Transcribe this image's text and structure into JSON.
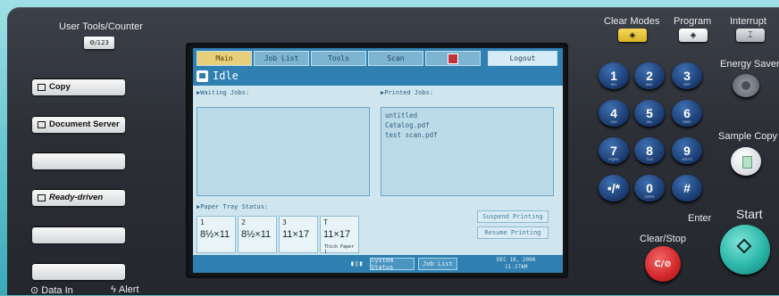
{
  "panel": {
    "user_tools_label": "User Tools/Counter",
    "user_tools_key_icon": "⚙/123",
    "data_in_label": "Data In",
    "alert_label": "Alert"
  },
  "function_keys": [
    {
      "label": "Copy",
      "icon": "copy-icon"
    },
    {
      "label": "Document Server",
      "icon": "document-server-icon"
    },
    {
      "label": ""
    },
    {
      "label": "Ready-driven",
      "icon": "printer-scanner-icon"
    },
    {
      "label": ""
    },
    {
      "label": ""
    }
  ],
  "screen": {
    "tabs": [
      "Main",
      "Job List",
      "Tools",
      "Scan",
      "",
      "Logout"
    ],
    "status": "Idle",
    "waiting_jobs_label": "▶Waiting Jobs:",
    "printed_jobs_label": "▶Printed Jobs:",
    "printed_jobs": [
      "untitled",
      "Catalog.pdf",
      "test scan.pdf"
    ],
    "paper_tray_label": "▶Paper Tray Status:",
    "trays": [
      {
        "num": "1",
        "size": "8½×11",
        "note": ""
      },
      {
        "num": "2",
        "size": "8½×11",
        "note": ""
      },
      {
        "num": "3",
        "size": "11×17",
        "note": ""
      },
      {
        "num": "T",
        "size": "11×17",
        "note": "Thick Paper 1"
      }
    ],
    "suspend_label": "Suspend Printing",
    "resume_label": "Resume Printing",
    "system_status_label": "System Status",
    "job_list_label": "Job List",
    "date": "DEC 18, 2008",
    "time": "11:27AM"
  },
  "right": {
    "clear_modes": "Clear Modes",
    "program": "Program",
    "interrupt": "Interrupt",
    "energy_saver": "Energy Saver",
    "sample_copy": "Sample Copy",
    "enter": "Enter",
    "clear_stop": "Clear/Stop",
    "start": "Start",
    "clear_stop_key": "C/⊘",
    "keys": [
      {
        "label": "1",
        "sub": "#01"
      },
      {
        "label": "2",
        "sub": "ABC"
      },
      {
        "label": "3",
        "sub": "DEF"
      },
      {
        "label": "4",
        "sub": "GHI"
      },
      {
        "label": "5",
        "sub": "JKL"
      },
      {
        "label": "6",
        "sub": "MNO"
      },
      {
        "label": "7",
        "sub": "PQRS"
      },
      {
        "label": "8",
        "sub": "TUV"
      },
      {
        "label": "9",
        "sub": "WXYZ"
      },
      {
        "label": "•/*",
        "sub": ""
      },
      {
        "label": "0",
        "sub": "OPER"
      },
      {
        "label": "#",
        "sub": ""
      }
    ]
  },
  "colors": {
    "accent_yellow": "#e8c537",
    "screen_blue": "#2f7fb0",
    "start_teal": "#2ab7a9",
    "stop_red": "#d3272b"
  }
}
